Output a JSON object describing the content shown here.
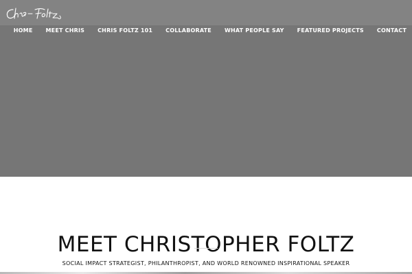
{
  "header": {
    "logo_alt": "Chris Foltz signature logo",
    "nav": [
      "HOME",
      "MEET CHRIS",
      "CHRIS FOLTZ 101",
      "COLLABORATE",
      "WHAT PEOPLE SAY",
      "FEATURED PROJECTS",
      "CONTACT"
    ]
  },
  "main": {
    "title": "MEET CHRISTOPHER FOLTZ",
    "subtitle": "SOCIAL IMPACT STRATEGIST, PHILANTHROPIST, AND WORLD RENOWNED INSPIRATIONAL SPEAKER"
  },
  "colors": {
    "hero_background": "#767676",
    "topbar_background": "#838383",
    "nav_text": "#ffffff",
    "title_text": "#111111"
  }
}
